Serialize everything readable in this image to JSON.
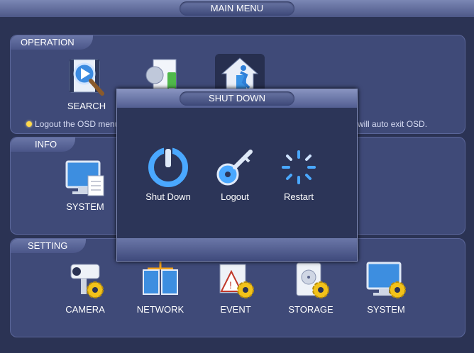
{
  "window": {
    "title": "MAIN MENU"
  },
  "operation": {
    "section_label": "OPERATION",
    "items": [
      {
        "label": "SEARCH",
        "icon": "search-video-icon"
      },
      {
        "label": "",
        "icon": "backup-usb-icon"
      },
      {
        "label": "",
        "icon": "shutdown-house-icon"
      }
    ],
    "hint_left": "Logout the OSD menu",
    "hint_right": "will auto exit OSD."
  },
  "info": {
    "section_label": "INFO",
    "items": [
      {
        "label": "SYSTEM",
        "icon": "monitor-document-icon"
      }
    ]
  },
  "setting": {
    "section_label": "SETTING",
    "items": [
      {
        "label": "CAMERA",
        "icon": "camera-gear-icon"
      },
      {
        "label": "NETWORK",
        "icon": "network-icon"
      },
      {
        "label": "EVENT",
        "icon": "event-gear-icon"
      },
      {
        "label": "STORAGE",
        "icon": "storage-gear-icon"
      },
      {
        "label": "SYSTEM",
        "icon": "monitor-gear-icon"
      }
    ]
  },
  "dialog": {
    "title": "SHUT DOWN",
    "options": [
      {
        "label": "Shut Down",
        "icon": "power-icon"
      },
      {
        "label": "Logout",
        "icon": "key-icon"
      },
      {
        "label": "Restart",
        "icon": "restart-spinner-icon"
      }
    ]
  },
  "colors": {
    "background": "#2b3354",
    "panel": "#3f4a78",
    "accent": "#4aa8ff",
    "gear": "#f2c21a"
  }
}
